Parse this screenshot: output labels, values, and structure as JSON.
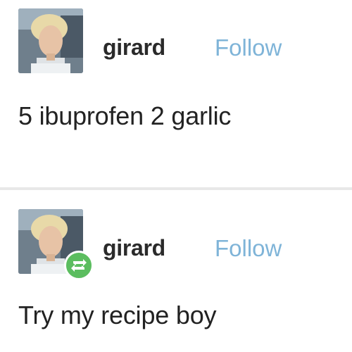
{
  "posts": [
    {
      "username": "girard",
      "follow_label": "Follow",
      "text": "5 ibuprofen 2 garlic",
      "avatar_icon": "user-avatar-icon"
    },
    {
      "username": "girard",
      "follow_label": "Follow",
      "text": "Try my recipe boy",
      "avatar_icon": "user-avatar-icon",
      "badge_icon": "reblog-icon"
    }
  ],
  "colors": {
    "follow": "#7fb4d8",
    "reblog_badge": "#5bbd5f",
    "divider": "#e8e8e8"
  }
}
